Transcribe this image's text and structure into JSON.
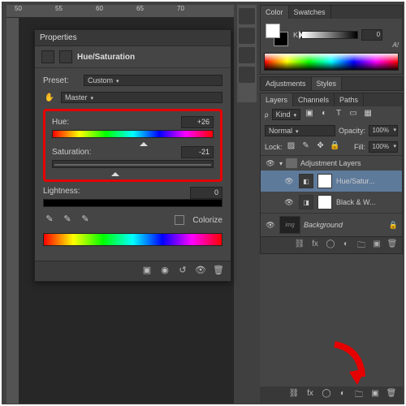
{
  "ruler_ticks": [
    "50",
    "55",
    "60",
    "65",
    "70"
  ],
  "properties": {
    "panel_title": "Properties",
    "adjustment_name": "Hue/Saturation",
    "preset_label": "Preset:",
    "preset_value": "Custom",
    "channel_value": "Master",
    "hue_label": "Hue:",
    "hue_value": "+26",
    "saturation_label": "Saturation:",
    "saturation_value": "-21",
    "lightness_label": "Lightness:",
    "lightness_value": "0",
    "colorize_label": "Colorize"
  },
  "color_panel": {
    "tab_color": "Color",
    "tab_swatches": "Swatches",
    "channel": "K",
    "value": "0",
    "warn": "A!"
  },
  "adjust_panel": {
    "tab_adjustments": "Adjustments",
    "tab_styles": "Styles"
  },
  "layers_panel": {
    "tabs": [
      "Layers",
      "Channels",
      "Paths"
    ],
    "filter_kind": "Kind",
    "blend_mode": "Normal",
    "opacity_label": "Opacity:",
    "opacity_value": "100%",
    "lock_label": "Lock:",
    "fill_label": "Fill:",
    "fill_value": "100%",
    "group_name": "Adjustment Layers",
    "layer_hs": "Hue/Satur...",
    "layer_bw": "Black & W...",
    "layer_bg": "Background"
  }
}
